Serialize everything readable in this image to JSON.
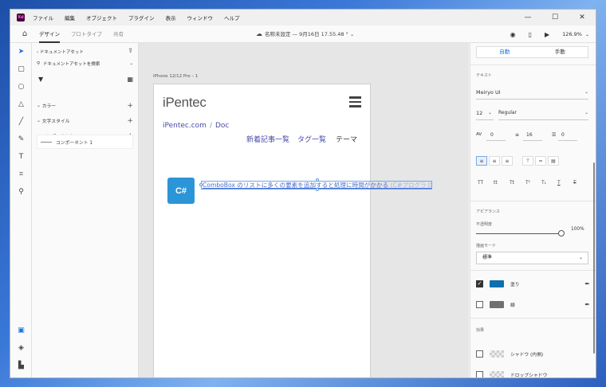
{
  "app": {
    "icon_text": "Xd",
    "menu": [
      "ファイル",
      "編集",
      "オブジェクト",
      "プラグイン",
      "表示",
      "ウィンドウ",
      "ヘルプ"
    ],
    "window_controls": {
      "minimize": "—",
      "maximize": "☐",
      "close": "✕"
    }
  },
  "toolbar": {
    "tabs": [
      "デザイン",
      "プロトタイプ",
      "共有"
    ],
    "active_tab": "デザイン",
    "doc_title": "名称未設定 — 9月16日 17.55.48 °  ⌄",
    "zoom": "126.9%"
  },
  "assets": {
    "header": "ドキュメントアセット",
    "search_placeholder": "ドキュメントアセットを検索",
    "sections": [
      "カラー",
      "文字スタイル",
      "コンポーネント"
    ],
    "component_item": "コンポーネント 1"
  },
  "canvas": {
    "artboard_label": "iPhone 12/12 Pro – 1",
    "logo": "iPentec",
    "breadcrumb": [
      "iPentec.com",
      "Doc"
    ],
    "breadcrumb_sep": "/",
    "nav": [
      "新着記事一覧",
      "タグ一覧",
      "テーマ"
    ],
    "badge": "C#",
    "link_text": "ComboBox のリストに多くの要素を追加すると処理に時間がかかる",
    "link_text_fade": " (C#プログラミング)"
  },
  "props": {
    "size_modes": [
      "自動",
      "手動"
    ],
    "active_size_mode": "自動",
    "text_section": "テキスト",
    "font_family": "Meiryo UI",
    "font_size": "12",
    "font_weight": "Regular",
    "char_spacing_icon": "AV",
    "char_spacing": "0",
    "line_spacing": "16",
    "para_spacing": "0",
    "transform_buttons": [
      "TT",
      "tt",
      "Tt",
      "T¹",
      "T₁",
      "T",
      "T"
    ],
    "appearance_section": "アピアランス",
    "opacity_label": "不透明度",
    "opacity_value": "100%",
    "blend_label": "描画モード",
    "blend_value": "標準",
    "fill_label": "塗り",
    "fill_color": "#0d6fae",
    "stroke_label": "線",
    "stroke_color": "#707070",
    "effects_section": "効果",
    "effects": [
      "シャドウ (内側)",
      "ドロップシャドウ"
    ]
  }
}
